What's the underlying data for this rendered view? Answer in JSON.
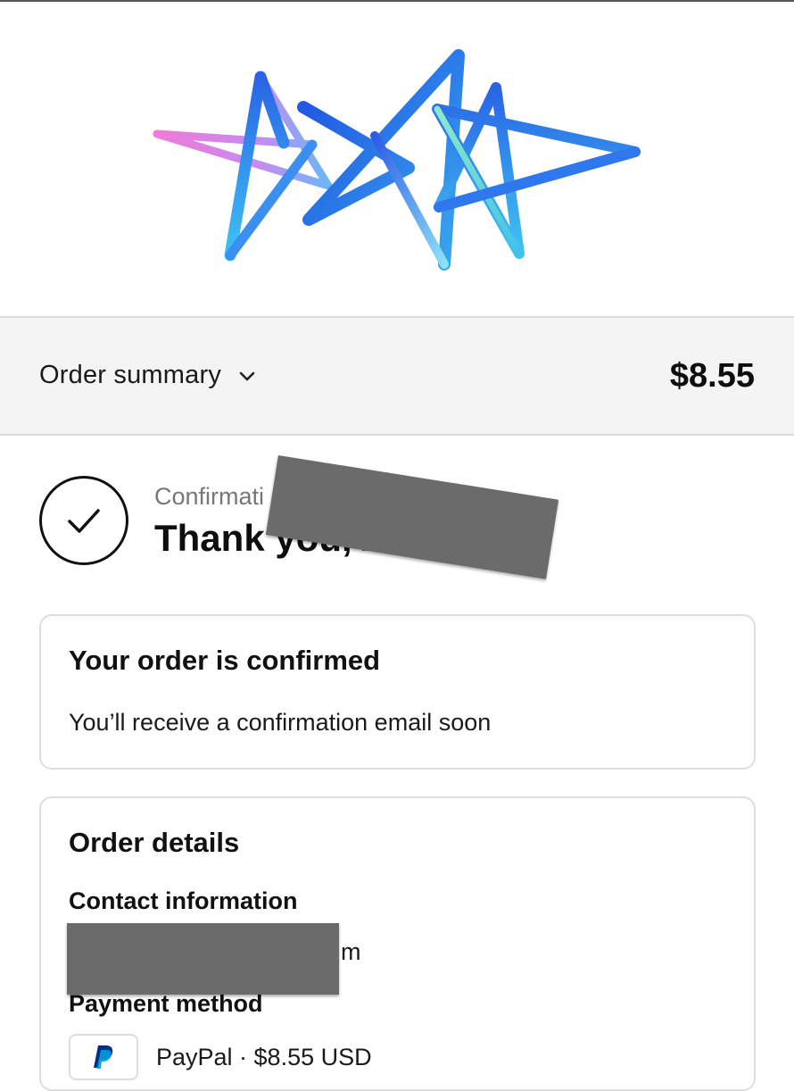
{
  "summary": {
    "label": "Order summary",
    "total": "$8.55"
  },
  "confirmation": {
    "number_text": "Confirmati",
    "thank_you": "Thank you, A"
  },
  "order_confirmed": {
    "title": "Your order is confirmed",
    "message": "You’ll receive a confirmation email soon"
  },
  "order_details": {
    "title": "Order details",
    "contact_heading": "Contact information",
    "contact_value": "m",
    "payment_heading": "Payment method",
    "payment_value": "PayPal · $8.55 USD"
  },
  "colors": {
    "summary_bar": "#f4f4f4",
    "card_border": "#dedede",
    "redaction": "#6b6b6b",
    "paypal_dark": "#003087",
    "paypal_light": "#009cde"
  },
  "icons": [
    "star-logo-icon",
    "chevron-down-icon",
    "checkmark-icon",
    "paypal-icon"
  ]
}
